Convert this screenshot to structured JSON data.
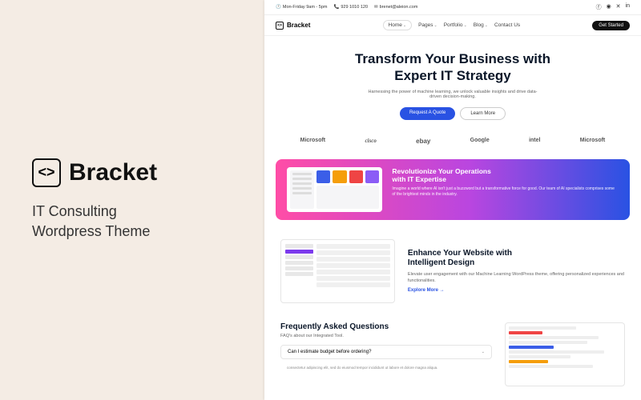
{
  "left": {
    "brand_name": "Bracket",
    "subtitle_line1": "IT Consulting",
    "subtitle_line2": "Wordpress Theme"
  },
  "topbar": {
    "hours": "Mon-Friday 9am - 5pm",
    "phone": "929 1010 120",
    "email": "brenet@aleion.com"
  },
  "nav": {
    "brand": "Bracket",
    "items": [
      "Home",
      "Pages",
      "Portfolio",
      "Blog",
      "Contact Us"
    ],
    "cta": "Get Started"
  },
  "hero": {
    "title_line1": "Transform Your Business with",
    "title_line2": "Expert IT Strategy",
    "subtitle": "Harnessing the power of machine learning, we unlock valuable insights and drive data-driven decision-making.",
    "btn_primary": "Request A Quote",
    "btn_secondary": "Learn More"
  },
  "brands": [
    "Microsoft",
    "cisco",
    "ebay",
    "Google",
    "intel",
    "Microsoft"
  ],
  "banner": {
    "title_line1": "Revolutionize Your Operations",
    "title_line2": "with IT Expertise",
    "body": "Imagine a world where AI isn't just a buzzword but a transformative force for good. Our team of AI specialists comprises some of the brightest minds in the industry."
  },
  "dash_colors": [
    "#3b5ee8",
    "#f59e0b",
    "#ef4444",
    "#8b5cf6"
  ],
  "feature": {
    "title_line1": "Enhance Your Website with",
    "title_line2": "Intelligent Design",
    "body": "Elevate user engagement with our Machine Learning WordPress theme, offering personalized experiences and functionalities.",
    "link": "Explore More →"
  },
  "faq": {
    "title": "Frequently Asked Questions",
    "subtitle": "FAQ's about our Integrated Tool.",
    "q1": "Can I estimate budget before ordering?",
    "q1_body": "consectetur adipiscing elit, sed do eiusmod tempor incididunt ut labore et dolore magna aliqua."
  }
}
